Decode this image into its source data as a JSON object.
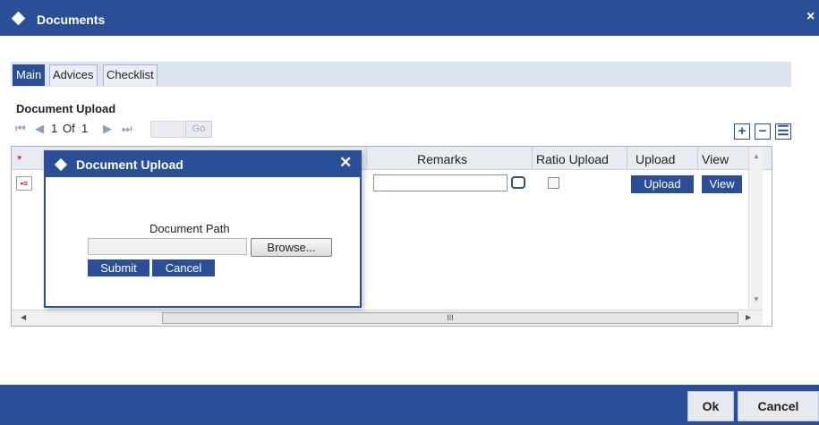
{
  "window": {
    "title": "Documents",
    "close_symbol": "×"
  },
  "tabs": [
    {
      "label": "Main",
      "active": true
    },
    {
      "label": "Advices",
      "active": false
    },
    {
      "label": "Checklist",
      "active": false
    }
  ],
  "section": {
    "label": "Document Upload"
  },
  "pager": {
    "first": "⏮",
    "prev": "◀",
    "current": "1",
    "of_label": "Of",
    "total": "1",
    "next": "▶",
    "last": "⏭",
    "go_label": "Go"
  },
  "toolbar": {
    "add_symbol": "+",
    "delete_symbol": "−",
    "view_symbol": "☰"
  },
  "grid": {
    "required_marker": "*",
    "columns": {
      "remarks": "Remarks",
      "ratio_upload": "Ratio Upload",
      "upload": "Upload",
      "view": "View"
    },
    "row": {
      "upload_label": "Upload",
      "view_label": "View"
    },
    "hscroll_grip": "III"
  },
  "dialog": {
    "title": "Document Upload",
    "close_symbol": "✕",
    "path_label": "Document Path",
    "path_value": "",
    "browse_label": "Browse...",
    "submit_label": "Submit",
    "cancel_label": "Cancel"
  },
  "footer": {
    "ok_label": "Ok",
    "cancel_label": "Cancel"
  }
}
